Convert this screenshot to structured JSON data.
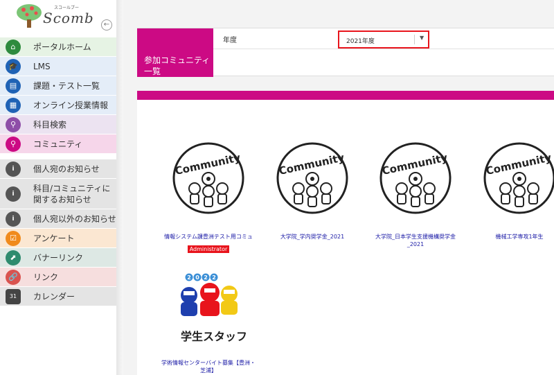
{
  "logo": {
    "text": "Scomb",
    "sub": "スコールブー"
  },
  "sidebar": {
    "collapse_icon": "←",
    "items": [
      {
        "label": "ポータルホーム",
        "icon": "home-icon",
        "icon_color": "#2e8b3e",
        "bg": "#e6f3e4",
        "glyph": "⌂"
      },
      {
        "label": "LMS",
        "icon": "graduation-cap-icon",
        "icon_color": "#1f62b5",
        "bg": "#e4edf8",
        "glyph": "🎓"
      },
      {
        "label": "課題・テスト一覧",
        "icon": "list-icon",
        "icon_color": "#1f62b5",
        "bg": "#e4edf8",
        "glyph": "▤"
      },
      {
        "label": "オンライン授業情報",
        "icon": "building-icon",
        "icon_color": "#1f62b5",
        "bg": "#e4edf8",
        "glyph": "▦"
      },
      {
        "label": "科目検索",
        "icon": "search-icon",
        "icon_color": "#8e4ea8",
        "bg": "#ece3f1",
        "glyph": "⚲"
      },
      {
        "label": "コミュニティ",
        "icon": "search-icon",
        "icon_color": "#cc0a84",
        "bg": "#f6d6ea",
        "glyph": "⚲"
      },
      {
        "label": "個人宛のお知らせ",
        "icon": "info-icon",
        "icon_color": "#555555",
        "bg": "#e4e4e4",
        "glyph": "i"
      },
      {
        "label": "科目/コミュニティに\n関するお知らせ",
        "icon": "info-icon",
        "icon_color": "#555555",
        "bg": "#e4e4e4",
        "glyph": "i"
      },
      {
        "label": "個人宛以外のお知らせ",
        "icon": "info-icon",
        "icon_color": "#555555",
        "bg": "#e4e4e4",
        "glyph": "i"
      },
      {
        "label": "アンケート",
        "icon": "checkbox-icon",
        "icon_color": "#f08a1c",
        "bg": "#fbe7d2",
        "glyph": "☑"
      },
      {
        "label": "バナーリンク",
        "icon": "banner-link-icon",
        "icon_color": "#2e8b6e",
        "bg": "#dde8e4",
        "glyph": "⬈"
      },
      {
        "label": "リンク",
        "icon": "link-icon",
        "icon_color": "#d9534f",
        "bg": "#f6dede",
        "glyph": "🔗"
      },
      {
        "label": "カレンダー",
        "icon": "calendar-icon",
        "icon_color": "#444444",
        "bg": "#e4e4e4",
        "glyph": "31"
      }
    ]
  },
  "main": {
    "card_title": "参加コミュニティ一覧",
    "year_label": "年度",
    "year_value": "2021年度"
  },
  "communities": [
    {
      "name": "情報システム課豊洲テスト用コミュ",
      "badge": "Administrator",
      "image": "community-logo",
      "image_text": "Community"
    },
    {
      "name": "大学院_学内奨学金_2021",
      "badge": "",
      "image": "community-logo",
      "image_text": "Community"
    },
    {
      "name": "大学院_日本学生支援機構奨学金_2021",
      "badge": "",
      "image": "community-logo",
      "image_text": "Community"
    },
    {
      "name": "機械工学専攻1年生",
      "badge": "",
      "image": "community-logo",
      "image_text": "Community"
    },
    {
      "name": "学術情報センターバイト募集【豊洲・芝浦】",
      "badge": "",
      "image": "student-staff-logo",
      "image_text": "学生スタッフ",
      "image_year": "2022"
    }
  ]
}
